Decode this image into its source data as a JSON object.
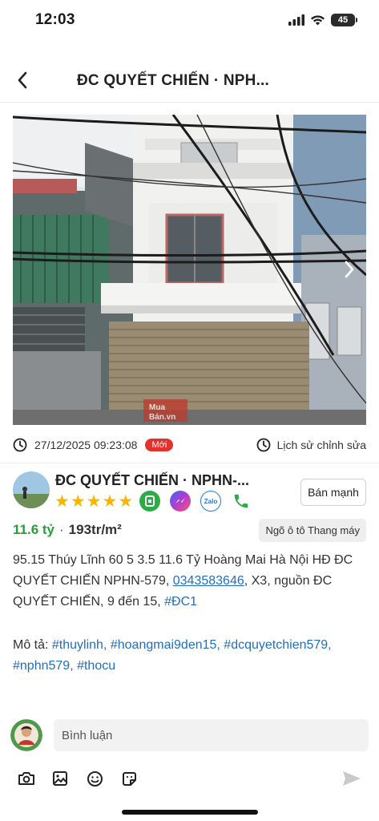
{
  "status_bar": {
    "time": "12:03",
    "battery": "45"
  },
  "header": {
    "title": "ĐC QUYẾT CHIẾN · NPH...",
    "back_icon": "chevron-left-icon"
  },
  "photo": {
    "watermark": "Mua Bán.vn",
    "next_icon": "chevron-right-icon"
  },
  "meta": {
    "timestamp": "27/12/2025 09:23:08",
    "new_badge": "Mới",
    "history_label": "Lịch sử chỉnh sửa"
  },
  "poster": {
    "name": "ĐC QUYẾT CHIẾN · NPHN-...",
    "rating": 5,
    "stars": [
      "★",
      "★",
      "★",
      "★",
      "★"
    ],
    "contacts": [
      "bds-icon",
      "messenger-icon",
      "zalo-icon",
      "phone-icon"
    ],
    "zalo_label": "Zalo",
    "action_label": "Bán mạnh"
  },
  "listing": {
    "price": "11.6 tỷ",
    "separator": "·",
    "area": "193tr/m²",
    "tags": "Ngõ ô tô Thang máy",
    "desc_part1": "95.15 Thúy Lĩnh 60 5 3.5 11.6 Tỷ Hoàng Mai Hà Nội HĐ ĐC QUYẾT CHIẾN NPHN-579, ",
    "desc_phone": "0343583646",
    "desc_part2": ", X3, nguồn ĐC QUYẾT CHIẾN, 9 đến 15, ",
    "desc_hashtag": "#ĐC1",
    "mota_label": "Mô tả: ",
    "mota_tags": "#thuylinh, #hoangmai9den15, #dcquyetchien579, #nphn579, #thocu"
  },
  "comment": {
    "placeholder": "Bình luận"
  },
  "colors": {
    "price_green": "#2a9d3a",
    "link_blue": "#1f6fc1",
    "badge_red": "#e4312b",
    "star_yellow": "#f7b500"
  }
}
